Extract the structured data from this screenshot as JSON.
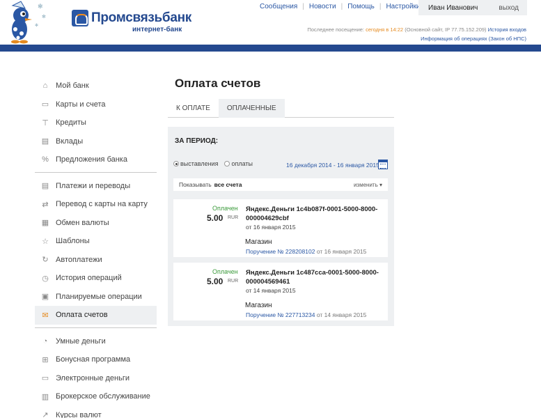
{
  "brand": {
    "name": "Промсвязьбанк",
    "subtitle": "интернет-банк",
    "color": "#24498f",
    "accent": "#e58a1f"
  },
  "topnav": [
    "Сообщения",
    "Новости",
    "Помощь",
    "Настройки"
  ],
  "user": {
    "name": "Иван Иванович",
    "logout": "выход"
  },
  "last_visit": {
    "label": "Последнее посещение:",
    "when": "сегодня в 14:22",
    "details": "(Основной сайт, IP 77.75.152.209)",
    "history_link": "История входов"
  },
  "op_info": "Информация об операциях (Закон об НПС)",
  "sidebar": {
    "group1": [
      {
        "label": "Мой банк",
        "icon": "home-icon"
      },
      {
        "label": "Карты и счета",
        "icon": "card-icon"
      },
      {
        "label": "Кредиты",
        "icon": "credit-icon"
      },
      {
        "label": "Вклады",
        "icon": "deposit-icon"
      },
      {
        "label": "Предложения банка",
        "icon": "offer-icon"
      }
    ],
    "group2": [
      {
        "label": "Платежи и переводы",
        "icon": "payments-icon"
      },
      {
        "label": "Перевод с карты на карту",
        "icon": "card-transfer-icon"
      },
      {
        "label": "Обмен валюты",
        "icon": "exchange-icon"
      },
      {
        "label": "Шаблоны",
        "icon": "star-icon"
      },
      {
        "label": "Автоплатежи",
        "icon": "autopay-icon"
      },
      {
        "label": "История операций",
        "icon": "history-icon"
      },
      {
        "label": "Планируемые операции",
        "icon": "calendar-icon"
      },
      {
        "label": "Оплата счетов",
        "icon": "bill-icon",
        "active": true
      }
    ],
    "group3": [
      {
        "label": "Умные деньги",
        "icon": "clock-icon"
      },
      {
        "label": "Бонусная программа",
        "icon": "gift-icon"
      },
      {
        "label": "Электронные деньги",
        "icon": "wallet-icon"
      },
      {
        "label": "Брокерское обслуживание",
        "icon": "chart-icon"
      },
      {
        "label": "Курсы валют",
        "icon": "rates-icon"
      }
    ]
  },
  "main": {
    "title": "Оплата счетов",
    "tabs": [
      {
        "label": "К оплате",
        "active": false
      },
      {
        "label": "Оплаченные",
        "active": true
      }
    ],
    "period": {
      "title": "ЗА ПЕРИОД:",
      "radio_issued": "выставления",
      "radio_paid": "оплаты",
      "range": "16 декабря 2014 - 16 января 2015"
    },
    "show": {
      "label": "Показывать",
      "value": "все счета",
      "change": "изменить ▾"
    },
    "bills": [
      {
        "status": "Оплачен",
        "amount": "5.00",
        "currency": "RUR",
        "title": "Яндекс.Деньги 1c4b087f-0001-5000-8000-000004629cbf",
        "date": "от 16 января 2015",
        "payee": "Магазин",
        "order": "Поручение № 228208102",
        "order_date": "от 16 января 2015"
      },
      {
        "status": "Оплачен",
        "amount": "5.00",
        "currency": "RUR",
        "title": "Яндекс.Деньги 1c487cca-0001-5000-8000-000004569461",
        "date": "от 14 января 2015",
        "payee": "Магазин",
        "order": "Поручение № 227713234",
        "order_date": "от 14 января 2015"
      }
    ]
  }
}
